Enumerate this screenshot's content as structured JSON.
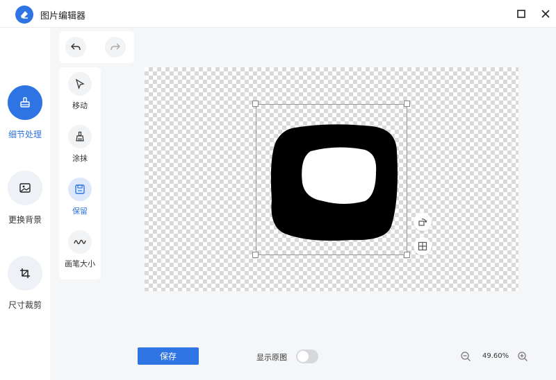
{
  "window": {
    "title": "图片编辑器",
    "icons": {
      "logo": "eraser-logo-icon",
      "maximize": "maximize-icon",
      "close": "close-icon"
    }
  },
  "left_tools": [
    {
      "label": "细节处理",
      "icon": "brush-icon",
      "active": true
    },
    {
      "label": "更换背景",
      "icon": "image-icon",
      "active": false
    },
    {
      "label": "尺寸裁剪",
      "icon": "crop-icon",
      "active": false
    }
  ],
  "history": {
    "undo_icon": "undo-icon",
    "redo_icon": "redo-icon"
  },
  "brush_tools": [
    {
      "label": "移动",
      "icon": "cursor-icon",
      "active": false
    },
    {
      "label": "涂抹",
      "icon": "broom-icon",
      "active": false
    },
    {
      "label": "保留",
      "icon": "save-box-icon",
      "active": true
    },
    {
      "label": "画笔大小",
      "icon": "squiggle-icon",
      "active": false
    }
  ],
  "canvas": {
    "side_buttons": [
      "rotate-icon",
      "grid-icon"
    ]
  },
  "footer": {
    "save_label": "保存",
    "show_original_label": "显示原图",
    "show_original_on": false,
    "zoom_level": "49.60%",
    "zoom_out_icon": "zoom-out-icon",
    "zoom_in_icon": "zoom-in-icon"
  },
  "colors": {
    "accent": "#2f74e3",
    "panel": "#ffffff",
    "background": "#f5f6f8",
    "toggle_off": "#d6d8dc"
  }
}
